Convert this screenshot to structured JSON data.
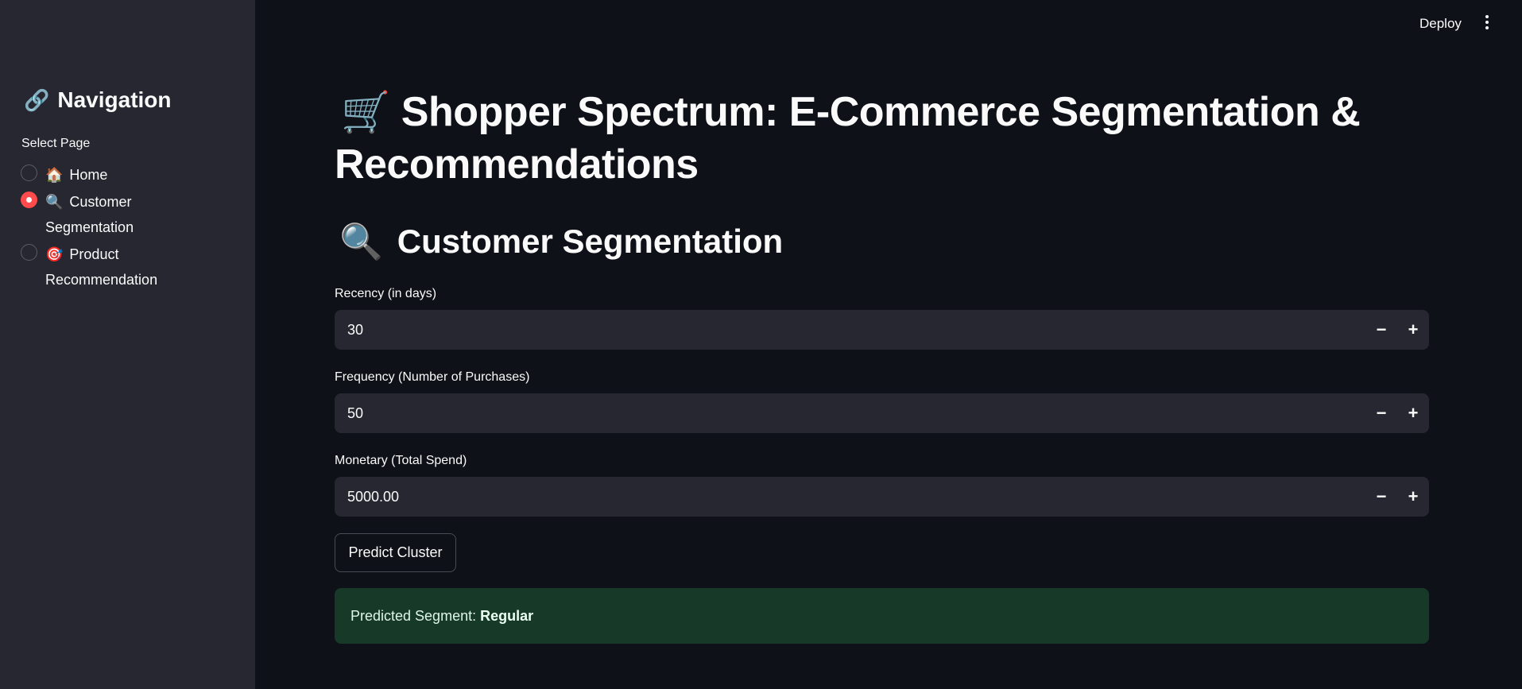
{
  "header": {
    "deploy_label": "Deploy",
    "menu_icon": "more-vertical-icon"
  },
  "sidebar": {
    "title": "Navigation",
    "title_icon": "🔗",
    "select_label": "Select Page",
    "items": [
      {
        "icon": "🏠",
        "label": "Home",
        "selected": false
      },
      {
        "icon": "🔍",
        "label": "Customer Segmentation",
        "selected": true
      },
      {
        "icon": "🎯",
        "label": "Product Recommendation",
        "selected": false
      }
    ]
  },
  "main": {
    "title": "Shopper Spectrum: E-Commerce Segmentation & Recommendations",
    "title_icon": "🛒",
    "section_title": "Customer Segmentation",
    "section_icon": "🔍",
    "fields": [
      {
        "label": "Recency (in days)",
        "value": "30"
      },
      {
        "label": "Frequency (Number of Purchases)",
        "value": "50"
      },
      {
        "label": "Monetary (Total Spend)",
        "value": "5000.00"
      }
    ],
    "minus_label": "−",
    "plus_label": "+",
    "predict_button": "Predict Cluster",
    "result_prefix": "Predicted Segment:",
    "result_value": "Regular"
  },
  "colors": {
    "accent": "#ff4b4b",
    "success_bg": "#173928",
    "sidebar_bg": "#262730",
    "main_bg": "#0e1117"
  }
}
